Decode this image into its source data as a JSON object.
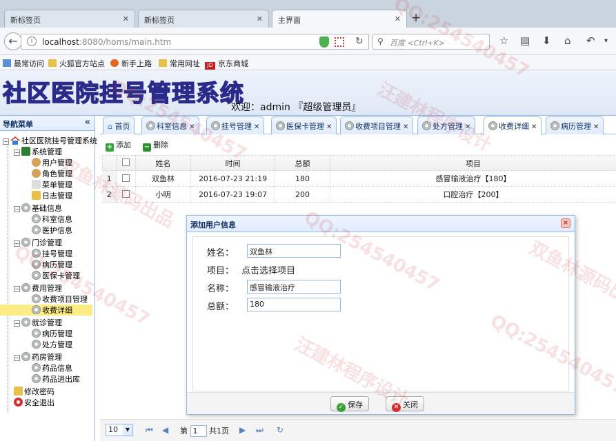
{
  "browser": {
    "tabs": [
      {
        "label": "新标签页"
      },
      {
        "label": "新标签页"
      },
      {
        "label": "主界面"
      }
    ],
    "new_tab": "+",
    "url_host": "localhost",
    "url_rest": ":8080/homs/main.htm",
    "search_placeholder": "百度 <Ctrl+K>",
    "bookmarks": [
      "最常访问",
      "火狐官方站点",
      "新手上路",
      "常用网址",
      "京东商城"
    ],
    "jd_badge": "JD"
  },
  "app": {
    "title": "社区医院挂号管理系统",
    "welcome": "欢迎：admin 『超级管理员』"
  },
  "nav": {
    "title": "导航菜单",
    "collapse": "«",
    "root": "社区医院挂号管理系统",
    "groups": [
      {
        "label": "系统管理",
        "items": [
          "用户管理",
          "角色管理",
          "菜单管理",
          "日志管理"
        ]
      },
      {
        "label": "基础信息",
        "items": [
          "科室信息",
          "医护信息"
        ]
      },
      {
        "label": "门诊管理",
        "items": [
          "挂号管理",
          "病历管理",
          "医保卡管理"
        ]
      },
      {
        "label": "费用管理",
        "items": [
          "收费项目管理",
          "收费详细"
        ]
      },
      {
        "label": "就诊管理",
        "items": [
          "病历管理",
          "处方管理"
        ]
      },
      {
        "label": "药房管理",
        "items": [
          "药品信息",
          "药品进出库"
        ]
      }
    ],
    "extras": [
      "修改密码",
      "安全退出"
    ],
    "selected": "收费详细"
  },
  "tabs": [
    {
      "label": "首页"
    },
    {
      "label": "科室信息"
    },
    {
      "label": "挂号管理"
    },
    {
      "label": "医保卡管理"
    },
    {
      "label": "收费项目管理"
    },
    {
      "label": "处方管理"
    },
    {
      "label": "收费详细"
    },
    {
      "label": "病历管理"
    }
  ],
  "toolbar": {
    "add": "添加",
    "delete": "删除"
  },
  "grid": {
    "columns": [
      "姓名",
      "时间",
      "总额",
      "项目"
    ],
    "rows": [
      {
        "num": "1",
        "name": "双鱼林",
        "time": "2016-07-23 21:19",
        "total": "180",
        "item": "感冒输液治疗【180】"
      },
      {
        "num": "2",
        "name": "小明",
        "time": "2016-07-23 19:07",
        "total": "200",
        "item": "口腔治疗【200】"
      }
    ]
  },
  "pager": {
    "page_size": "10",
    "page_prefix": "第",
    "page_value": "1",
    "page_suffix": "共1页"
  },
  "dialog": {
    "title": "添加用户信息",
    "close": "×",
    "name_label": "姓名：",
    "name_value": "双鱼林",
    "item_label": "项目：",
    "item_value": "点击选择项目",
    "title_label": "名称：",
    "title_value": "感冒输液治疗",
    "total_label": "总额：",
    "total_value": "180",
    "save": "保存",
    "cancel": "关闭"
  },
  "watermarks": [
    "QQ:254540457",
    "双鱼林源码出品",
    "汪建林程序设计"
  ]
}
